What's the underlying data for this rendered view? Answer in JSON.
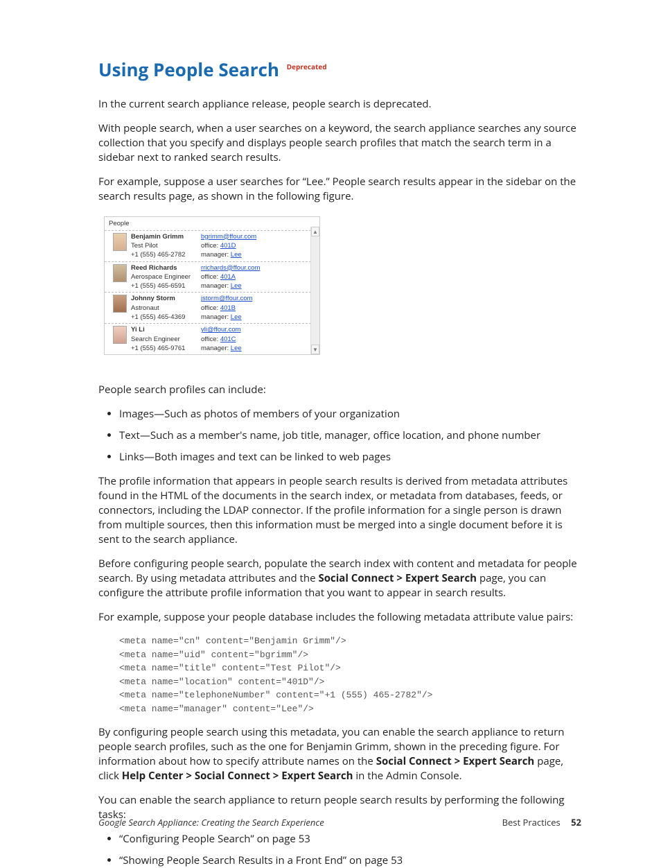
{
  "heading": {
    "title": "Using People Search",
    "badge": "Deprecated"
  },
  "para": {
    "p1": "In the current search appliance release, people search is deprecated.",
    "p2": "With people search, when a user searches on a keyword, the search appliance searches any source collection that you specify and displays people search profiles that match the search term in a sidebar next to ranked search results.",
    "p3": "For example, suppose a user searches for “Lee.” People search results appear in the sidebar on the search results page, as shown in the following figure.",
    "p4": "People search profiles can include:",
    "p5": "The profile information that appears in people search results is derived from metadata attributes found in the HTML of the documents in the search index, or metadata from databases, feeds, or connectors, including the LDAP connector. If the profile information for a single person is drawn from multiple sources, then this information must be merged into a single document before it is sent to the search appliance.",
    "p6a": "Before configuring people search, populate the search index with content and metadata for people search. By using metadata attributes and the ",
    "p6b": "Social Connect > Expert Search",
    "p6c": " page, you can configure the attribute profile information that you want to appear in search results.",
    "p7": "For example, suppose your people database includes the following metadata attribute value pairs:",
    "p8a": "By configuring people search using this metadata, you can enable the search appliance to return people search profiles, such as the one for Benjamin Grimm, shown in the preceding figure. For information about how to specify attribute names on the ",
    "p8b": "Social Connect > Expert Search",
    "p8c": " page, click ",
    "p8d": "Help Center > Social Connect > Expert Search",
    "p8e": " in the Admin Console.",
    "p9": "You can enable the search appliance to return people search results by performing the following tasks:"
  },
  "includes": {
    "i1": "Images—Such as photos of members of your organization",
    "i2": "Text—Such as a member's name, job title, manager, office location, and phone number",
    "i3": "Links—Both images and text can be linked to web pages"
  },
  "tasks": {
    "t1": "“Configuring People Search” on page 53",
    "t2": "“Showing People Search Results in a Front End” on page 53"
  },
  "code": "<meta name=\"cn\" content=\"Benjamin Grimm\"/>\n<meta name=\"uid\" content=\"bgrimm\"/>\n<meta name=\"title\" content=\"Test Pilot\"/>\n<meta name=\"location\" content=\"401D\"/>\n<meta name=\"telephoneNumber\" content=\"+1 (555) 465-2782\"/>\n<meta name=\"manager\" content=\"Lee\"/>",
  "people_widget": {
    "title": "People",
    "office_label": "office:",
    "manager_label": "manager:",
    "rows": [
      {
        "name": "Benjamin Grimm",
        "title": "Test Pilot",
        "phone": "+1 (555) 465-2782",
        "email": "bgrimm@ffour.com",
        "office": "401D",
        "manager": "Lee"
      },
      {
        "name": "Reed Richards",
        "title": "Aerospace Engineer",
        "phone": "+1 (555) 465-6591",
        "email": "rrichards@ffour.com",
        "office": "401A",
        "manager": "Lee"
      },
      {
        "name": "Johnny Storm",
        "title": "Astronaut",
        "phone": "+1 (555) 465-4369",
        "email": "jstorm@ffour.com",
        "office": "401B",
        "manager": "Lee"
      },
      {
        "name": "Yi Li",
        "title": "Search Engineer",
        "phone": "+1 (555) 465-9761",
        "email": "yli@ffour.com",
        "office": "401C",
        "manager": "Lee"
      }
    ]
  },
  "footer": {
    "doc_title": "Google Search Appliance: Creating the Search Experience",
    "section": "Best Practices",
    "page": "52"
  }
}
